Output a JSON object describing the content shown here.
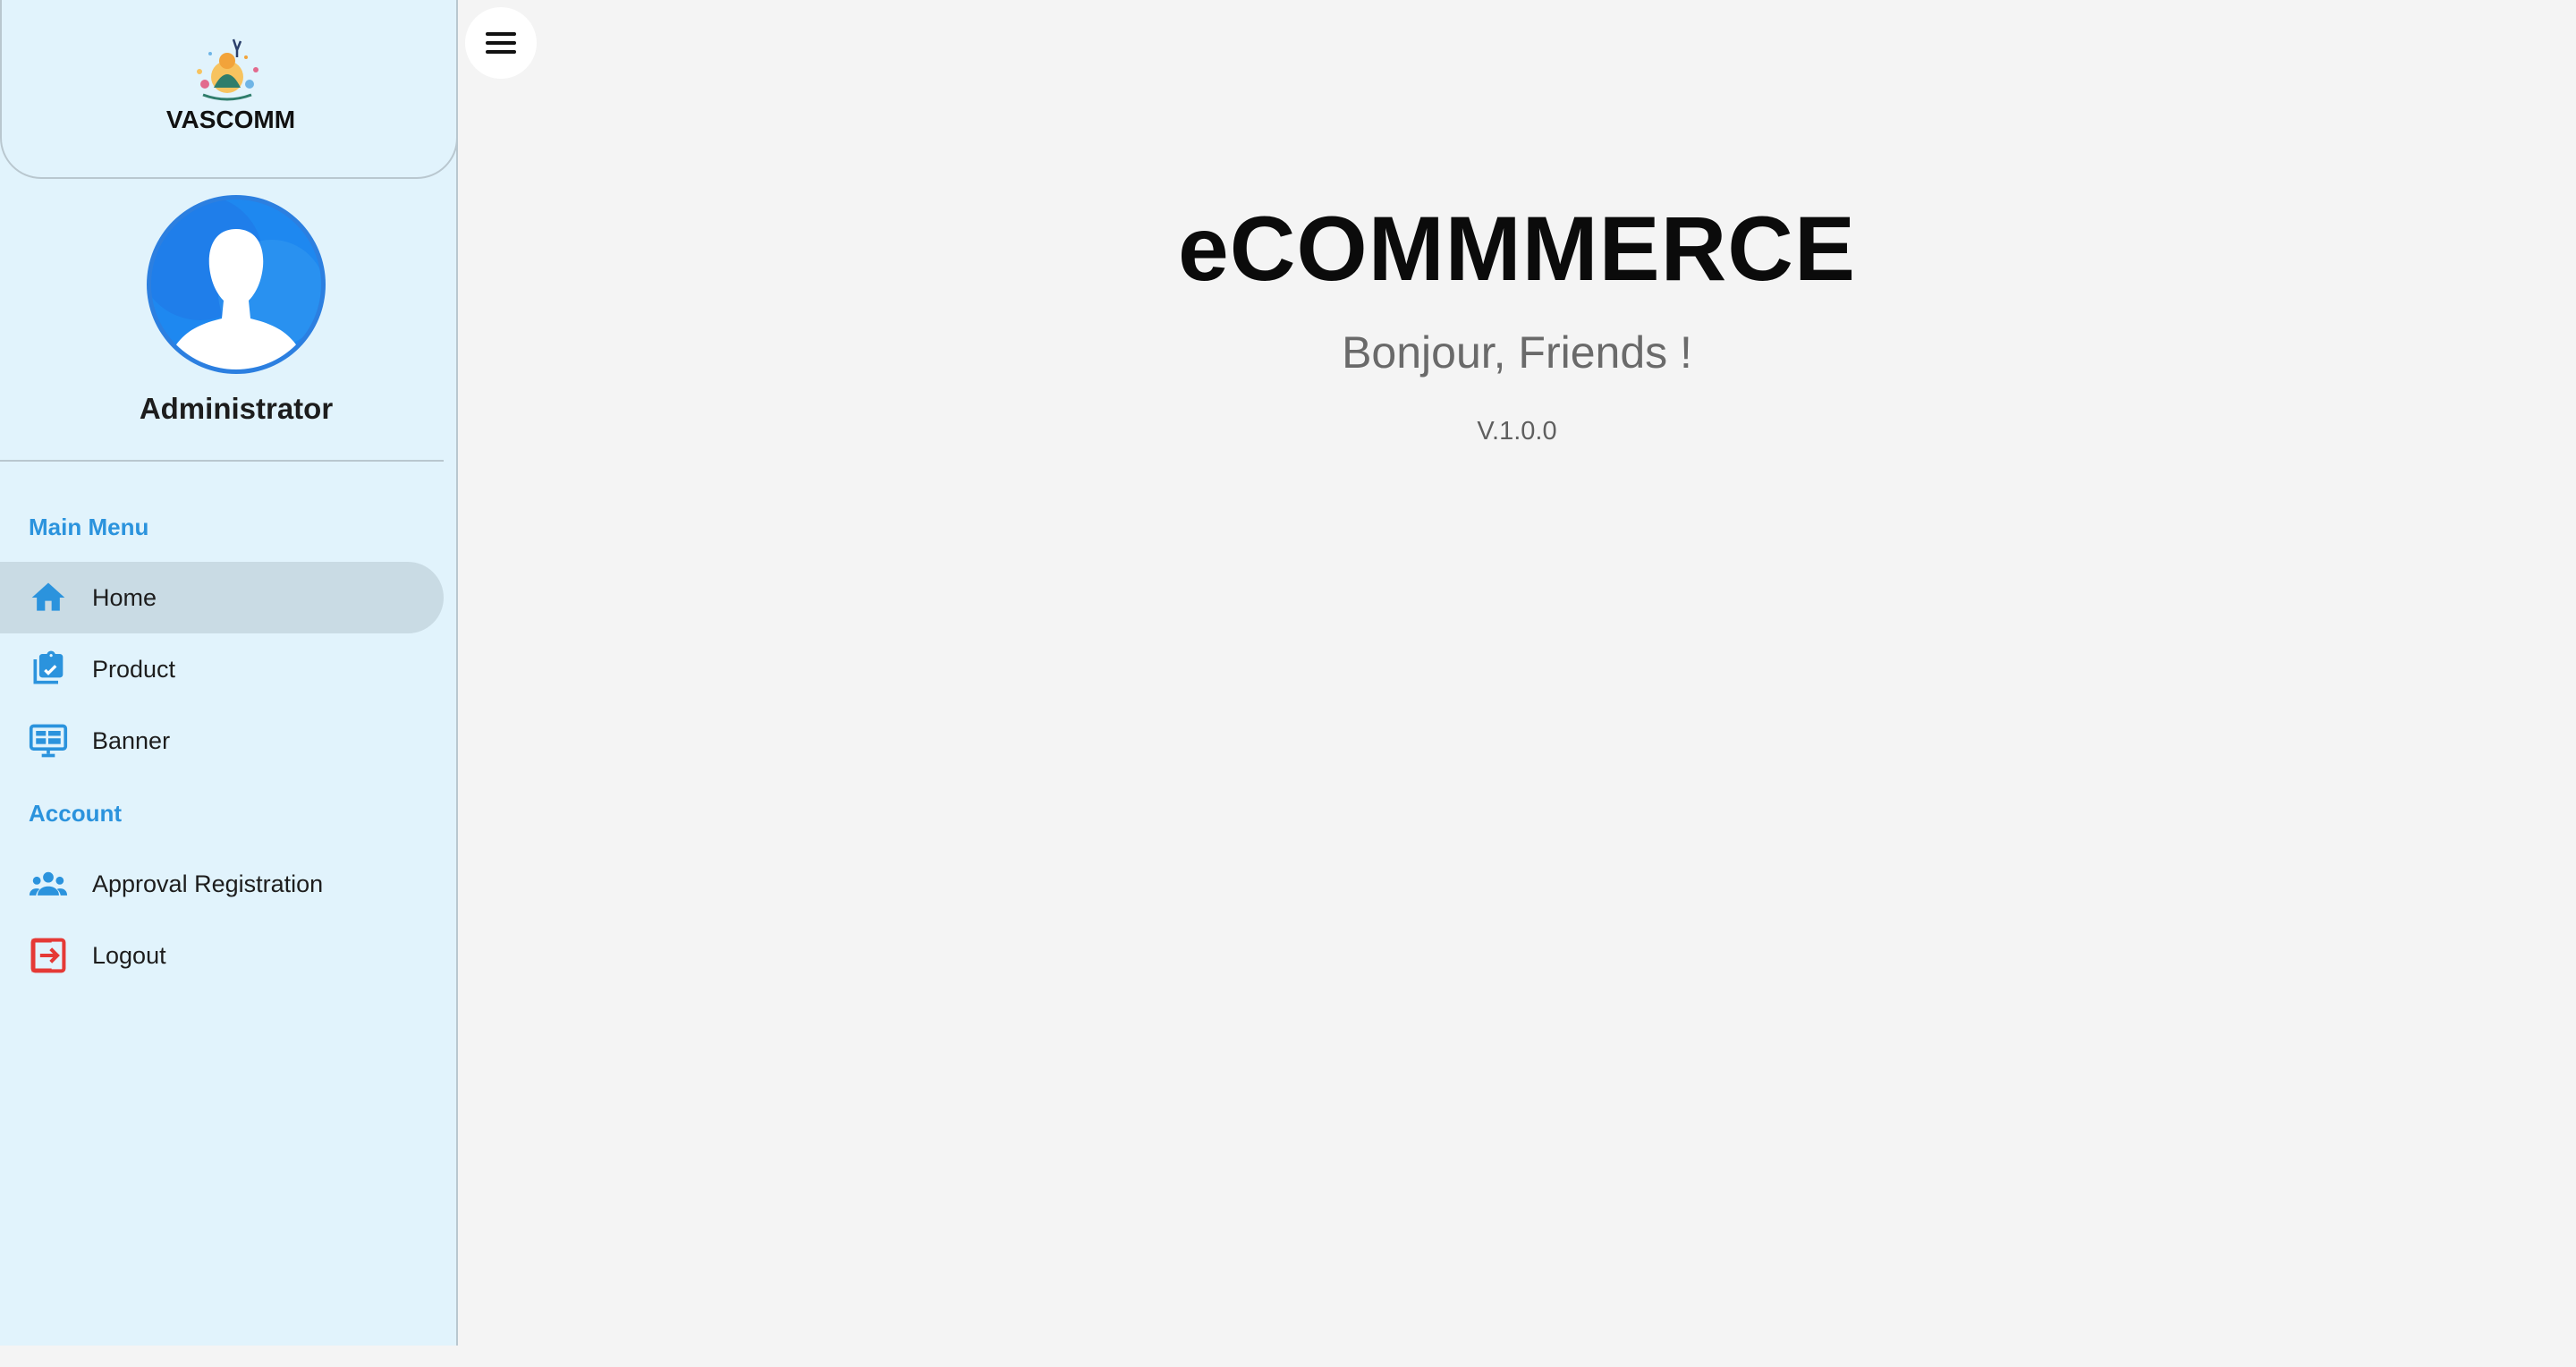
{
  "sidebar": {
    "brand_name": "VASCOMM",
    "user_name": "Administrator",
    "sections": [
      {
        "title": "Main Menu",
        "items": [
          {
            "label": "Home",
            "icon": "home-icon",
            "active": true
          },
          {
            "label": "Product",
            "icon": "clipboard-check-icon"
          },
          {
            "label": "Banner",
            "icon": "monitor-icon"
          }
        ]
      },
      {
        "title": "Account",
        "items": [
          {
            "label": "Approval Registration",
            "icon": "users-icon"
          },
          {
            "label": "Logout",
            "icon": "logout-icon"
          }
        ]
      }
    ]
  },
  "header": {
    "menu_icon": "hamburger-icon"
  },
  "main": {
    "title": "eCOMMMERCE",
    "greeting": "Bonjour, Friends !",
    "version": "V.1.0.0"
  },
  "colors": {
    "accent": "#2b93dd",
    "sidebar_bg": "#e1f3fc",
    "active_item_bg": "#c9dbe4",
    "logout_icon": "#e53935",
    "page_bg": "#f4f4f4"
  }
}
